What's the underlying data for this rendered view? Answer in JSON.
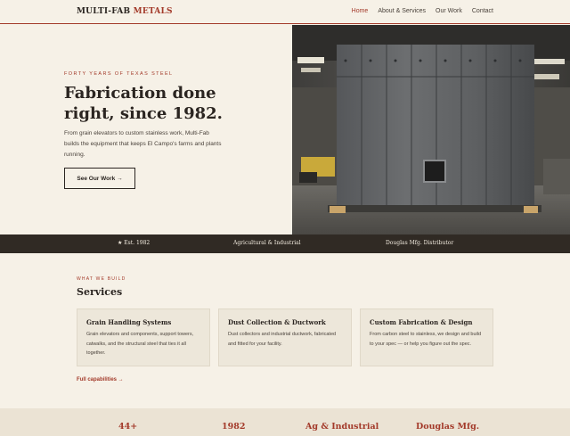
{
  "header": {
    "logo_part1": "MULTI-FAB",
    "logo_part2": "METALS",
    "nav": [
      {
        "label": "Home",
        "active": true
      },
      {
        "label": "About & Services",
        "active": false
      },
      {
        "label": "Our Work",
        "active": false
      },
      {
        "label": "Contact",
        "active": false
      }
    ]
  },
  "hero": {
    "eyebrow": "FORTY YEARS OF TEXAS STEEL",
    "title": "Fabrication done right, since 1982.",
    "description": "From grain elevators to custom stainless work, Multi-Fab builds the equipment that keeps El Campo's farms and plants running.",
    "button": "See Our Work →"
  },
  "strip": {
    "items": [
      "★ Est. 1982",
      "Agricultural & Industrial",
      "Douglas Mfg. Distributor"
    ]
  },
  "services": {
    "eyebrow": "WHAT WE BUILD",
    "title": "Services",
    "cards": [
      {
        "title": "Grain Handling Systems",
        "text": "Grain elevators and components, support towers, catwalks, and the structural steel that ties it all together."
      },
      {
        "title": "Dust Collection & Ductwork",
        "text": "Dust collectors and industrial ductwork, fabricated and fitted for your facility."
      },
      {
        "title": "Custom Fabrication & Design",
        "text": "From carbon steel to stainless, we design and build to your spec — or help you figure out the spec."
      }
    ],
    "link": "Full capabilities →"
  },
  "stats": [
    "44+",
    "1982",
    "Ag & Industrial",
    "Douglas Mfg."
  ],
  "colors": {
    "accent": "#a33a2a",
    "background": "#f6f1e7",
    "dark": "#302a24",
    "card": "#ede7da"
  }
}
